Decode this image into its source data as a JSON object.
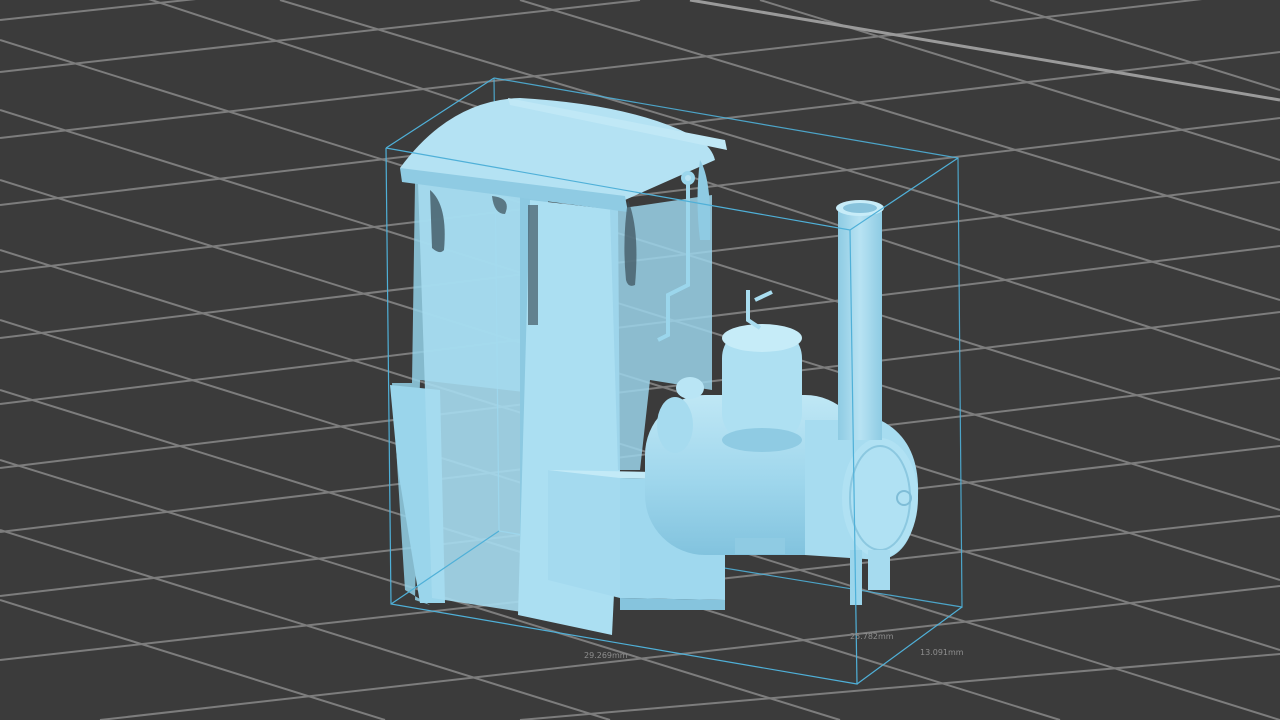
{
  "viewport": {
    "background": "#3b3b3b",
    "grid_color": "#7d7d7d",
    "model_color": "#a6dbef",
    "bbox_color": "#4fb0d8"
  },
  "dimensions": {
    "width": "29.269mm",
    "depth": "25.782mm",
    "height": "13.091mm"
  }
}
